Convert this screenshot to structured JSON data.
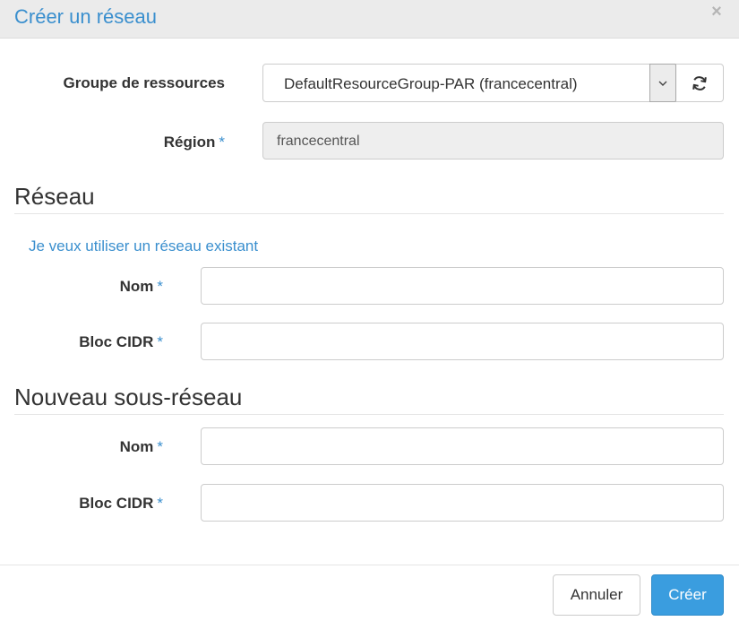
{
  "dialog": {
    "title": "Créer un réseau",
    "close_icon": "×"
  },
  "resource_group": {
    "label": "Groupe de ressources",
    "selected": "DefaultResourceGroup-PAR (francecentral)",
    "caret_icon": "chevron-down-icon",
    "refresh_icon": "refresh-icon"
  },
  "region": {
    "label": "Région",
    "required": "*",
    "value": "francecentral"
  },
  "network": {
    "section_title": "Réseau",
    "existing_link": "Je veux utiliser un réseau existant",
    "name_label": "Nom",
    "name_required": "*",
    "name_value": "",
    "cidr_label": "Bloc CIDR",
    "cidr_required": "*",
    "cidr_value": ""
  },
  "subnet": {
    "section_title": "Nouveau sous-réseau",
    "name_label": "Nom",
    "name_required": "*",
    "name_value": "",
    "cidr_label": "Bloc CIDR",
    "cidr_required": "*",
    "cidr_value": ""
  },
  "footer": {
    "cancel_label": "Annuler",
    "create_label": "Créer"
  },
  "colors": {
    "accent": "#3a8fce",
    "primary_button": "#3a9ddf",
    "header_bg": "#ebebeb",
    "readonly_bg": "#eeeeee"
  }
}
